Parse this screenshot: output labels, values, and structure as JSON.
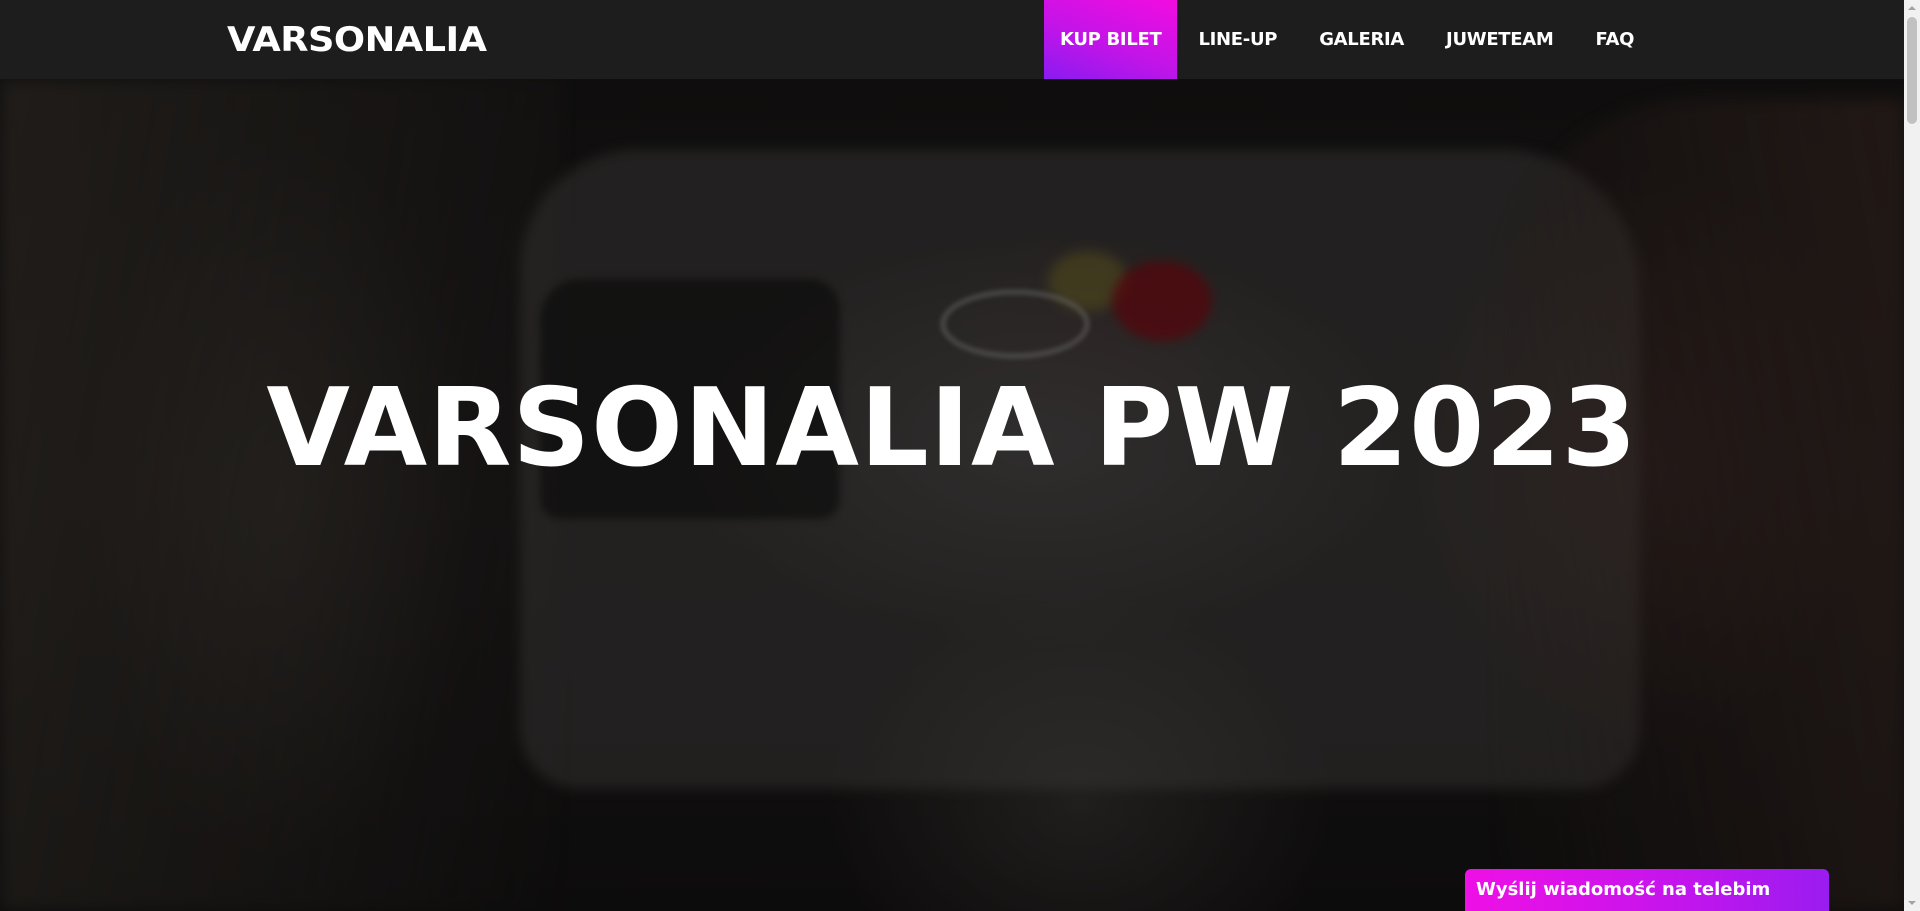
{
  "header": {
    "logo_text": "VARSONALIA",
    "nav": [
      {
        "label": "KUP BILET",
        "highlight": true
      },
      {
        "label": "LINE-UP"
      },
      {
        "label": "GALERIA"
      },
      {
        "label": "JUWETEAM"
      },
      {
        "label": "FAQ"
      }
    ]
  },
  "hero": {
    "title": "VARSONALIA PW 2023"
  },
  "telebim_button": {
    "label": "Wyślij wiadomość na telebim"
  },
  "colors": {
    "navbar_bg": "#1e1d1e",
    "accent_pink": "#f20ce0",
    "accent_purple": "#8a1bf0"
  }
}
